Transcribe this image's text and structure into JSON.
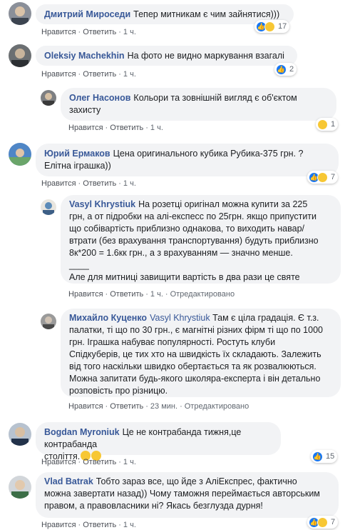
{
  "ui": {
    "like_label": "Нравится",
    "reply_label": "Ответить",
    "edited_label": "Отредактировано",
    "separator": "·"
  },
  "comments": [
    {
      "author": "Дмитрий Мироседи",
      "text": "Тепер митникам є чим зайнятися)))",
      "time": "1 ч.",
      "reactions": {
        "types": [
          "like",
          "haha"
        ],
        "count": "17"
      }
    },
    {
      "author": "Oleksiy Machekhin",
      "text": "На фото не видно маркування взагалі",
      "time": "1 ч.",
      "reactions": {
        "types": [
          "like"
        ],
        "count": "2"
      }
    },
    {
      "author": "Олег Насонов",
      "text_line1": "Кольори та зовнішній вигляд є об'єктом",
      "text_line2": "захисту",
      "time": "1 ч.",
      "reactions": {
        "types": [
          "haha"
        ],
        "count": "1"
      }
    },
    {
      "author": "Юрий Ермаков",
      "text_line1": "Цена оригинального кубика Рубика-375 грн. ?",
      "text_line2": "Елітна іграшка))",
      "time": "1 ч.",
      "reactions": {
        "types": [
          "like",
          "haha"
        ],
        "count": "7"
      }
    },
    {
      "author": "Vasyl Khrystiuk",
      "lines": [
        "На розетці оригінал можна купити за 225",
        "грн, а от підробки на алі-експесс по 25грн. якщо припустити",
        "що собівартість приблизно однакова, то виходить навар/",
        "втрати (без врахування транспортування) будуть приблизно",
        "8к*200 = 1.6кк грн., а з врахуванням — значно менше.",
        "____",
        "Але для митниці завищити вартість в два рази це святе"
      ],
      "time": "1 ч.",
      "edited": true
    },
    {
      "author": "Михайло Куценко",
      "mention": "Vasyl Khrystiuk",
      "lines": [
        "Там є ціла градація. Є т.з.",
        "палатки, ті що по 30 грн., є магнітні різних фірм ті що по 1000",
        "грн. Іграшка набуває популярності. Ростуть клуби",
        "Спідкуберів, це тих хто на швидкість їх складають. Залежить",
        "від того наскільки швидко обертається та як розвалюються.",
        "Можна запитати будь-якого школяра-експерта і він детально",
        "розповість про різницю."
      ],
      "time": "23 мин.",
      "edited": true
    },
    {
      "author": "Bogdan Myroniuk",
      "text_line1": "Це не контрабанда тижня,це контрабанда",
      "text_line2": "століття.",
      "time": "1 ч.",
      "reactions": {
        "types": [
          "like"
        ],
        "count": "15"
      }
    },
    {
      "author": "Vlad Batrak",
      "lines": [
        "Тобто зараз все, що йде з АліЕкспрес, фактично",
        "можна завертати назад)) Чому таможня переймається авторським",
        "правом, а правовласники ні? Якась безглузда дурня!"
      ],
      "time": "1 ч.",
      "reactions": {
        "types": [
          "like",
          "haha"
        ],
        "count": "7"
      }
    }
  ],
  "colors": {
    "name": "#385898",
    "bubble": "#f2f3f5",
    "meta": "#606770",
    "like": "#1877f2",
    "haha": "#f7c734"
  }
}
